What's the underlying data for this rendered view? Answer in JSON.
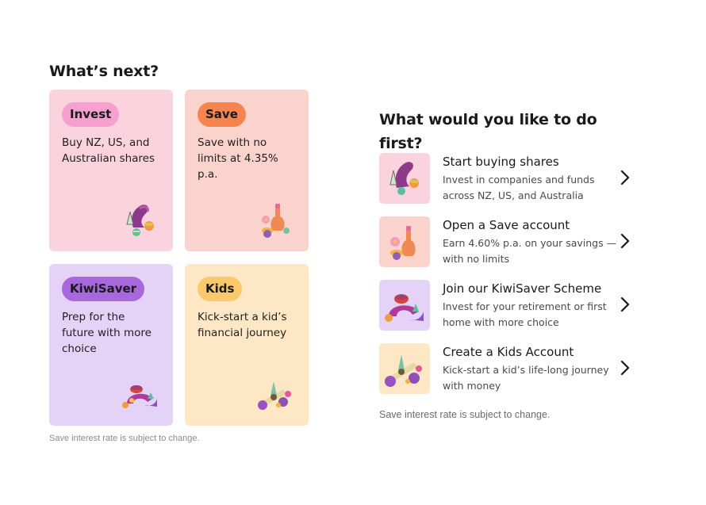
{
  "left": {
    "heading": "What’s next?",
    "cards": [
      {
        "tag": "Invest",
        "text": "Buy NZ, US, and Australian shares",
        "icon": "invest-shapes-icon"
      },
      {
        "tag": "Save",
        "text": "Save with no limits at 4.35% p.a.",
        "icon": "save-shapes-icon"
      },
      {
        "tag": "KiwiSaver",
        "text": "Prep for the future with more choice",
        "icon": "kiwisaver-shapes-icon"
      },
      {
        "tag": "Kids",
        "text": "Kick-start a kid’s financial journey",
        "icon": "kids-shapes-icon"
      }
    ],
    "note": "Save interest rate is subject to change."
  },
  "right": {
    "heading": "What would you like to do first?",
    "items": [
      {
        "title": "Start buying shares",
        "subtitle": "Invest in companies and funds across NZ, US, and Australia",
        "icon": "invest-shapes-icon"
      },
      {
        "title": "Open a Save account",
        "subtitle": "Earn 4.60% p.a. on your savings —with no limits",
        "icon": "save-shapes-icon"
      },
      {
        "title": "Join our KiwiSaver Scheme",
        "subtitle": "Invest for your retirement or first home with more choice",
        "icon": "kiwisaver-shapes-icon"
      },
      {
        "title": "Create a Kids Account",
        "subtitle": "Kick-start a kid’s life-long journey with money",
        "icon": "kids-shapes-icon"
      }
    ],
    "note": "Save interest rate is subject to change."
  },
  "colors": {
    "invest_bg": "#fad3de",
    "invest_pill": "#f6a0ce",
    "save_bg": "#fbd3cd",
    "save_pill": "#f5844e",
    "kiwisaver_bg": "#e5d2f7",
    "kiwisaver_pill": "#a767dd",
    "kids_bg": "#fde7c4",
    "kids_pill": "#fbc96b"
  }
}
